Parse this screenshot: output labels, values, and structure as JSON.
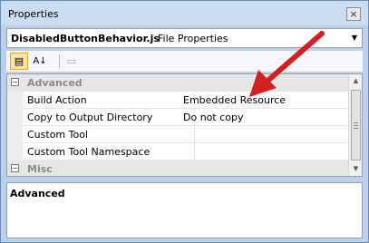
{
  "window": {
    "title": "Properties",
    "close_glyph": "×"
  },
  "object_selector": {
    "name": "DisabledButtonBehavior.js",
    "type": "File Properties",
    "dropdown_glyph": "▼"
  },
  "toolbar": {
    "categorized_glyph": "▤",
    "alphabetical_glyph": "A↓",
    "property_pages_glyph": "▭"
  },
  "grid": {
    "categories": [
      {
        "label": "Advanced",
        "expander": "−"
      },
      {
        "label": "Misc",
        "expander": "−"
      }
    ],
    "properties": [
      {
        "name": "Build Action",
        "value": "Embedded Resource"
      },
      {
        "name": "Copy to Output Directory",
        "value": "Do not copy"
      },
      {
        "name": "Custom Tool",
        "value": ""
      },
      {
        "name": "Custom Tool Namespace",
        "value": ""
      }
    ],
    "scroll_up": "▲",
    "scroll_down": "▼"
  },
  "description": {
    "title": "Advanced"
  },
  "colors": {
    "accent_arrow": "#d42020",
    "category_bg": "#e6e6e6",
    "window_frame": "#b9d1ea"
  }
}
